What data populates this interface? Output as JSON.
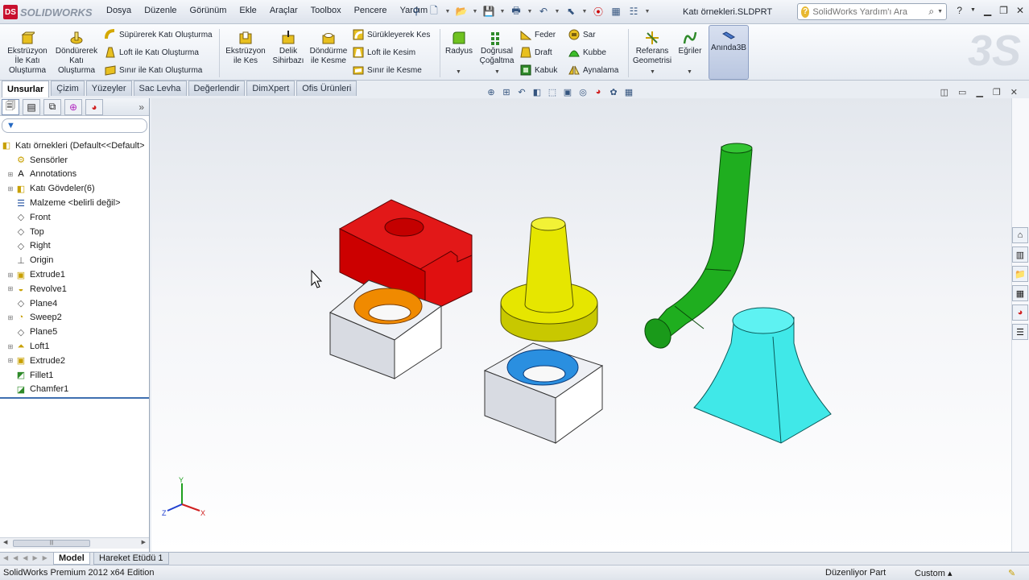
{
  "app": {
    "logo_text": "SOLIDWORKS",
    "document_title": "Katı örnekleri.SLDPRT"
  },
  "menu": [
    "Dosya",
    "Düzenle",
    "Görünüm",
    "Ekle",
    "Araçlar",
    "Toolbox",
    "Pencere",
    "Yardım"
  ],
  "help_search": {
    "placeholder": "SolidWorks Yardım'ı Ara"
  },
  "ribbon": {
    "extrude_boss": "Ekstrüzyon İle Katı Oluşturma",
    "revolve_boss": "Döndürerek Katı Oluşturma",
    "sweep_boss": "Süpürerek Katı Oluşturma",
    "loft_boss": "Loft ile Katı Oluşturma",
    "boundary_boss": "Sınır ile Katı Oluşturma",
    "extrude_cut": "Ekstrüzyon ile Kes",
    "hole_wizard": "Delik Sihirbazı",
    "revolve_cut": "Döndürme ile Kesme",
    "sweep_cut": "Sürükleyerek Kes",
    "loft_cut": "Loft ile Kesim",
    "boundary_cut": "Sınır ile Kesme",
    "fillet": "Radyus",
    "linear_pattern": "Doğrusal Çoğaltma",
    "rib": "Feder",
    "draft": "Draft",
    "shell": "Kabuk",
    "wrap": "Sar",
    "dome": "Kubbe",
    "mirror": "Aynalama",
    "ref_geometry": "Referans Geometrisi",
    "curves": "Eğriler",
    "instant3d": "Anında3B"
  },
  "tabs": [
    "Unsurlar",
    "Çizim",
    "Yüzeyler",
    "Sac Levha",
    "Değerlendir",
    "DimXpert",
    "Ofis Ürünleri"
  ],
  "tree": {
    "root": "Katı örnekleri  (Default<<Default>",
    "items": [
      {
        "label": "Sensörler",
        "icon": "sensor-icon",
        "expandable": false
      },
      {
        "label": "Annotations",
        "icon": "annotations-icon",
        "expandable": true
      },
      {
        "label": "Katı Gövdeler(6)",
        "icon": "solid-bodies-icon",
        "expandable": true
      },
      {
        "label": "Malzeme <belirli değil>",
        "icon": "material-icon",
        "expandable": false
      },
      {
        "label": "Front",
        "icon": "plane-icon",
        "expandable": false
      },
      {
        "label": "Top",
        "icon": "plane-icon",
        "expandable": false
      },
      {
        "label": "Right",
        "icon": "plane-icon",
        "expandable": false
      },
      {
        "label": "Origin",
        "icon": "origin-icon",
        "expandable": false
      },
      {
        "label": "Extrude1",
        "icon": "extrude-icon",
        "expandable": true
      },
      {
        "label": "Revolve1",
        "icon": "revolve-icon",
        "expandable": true
      },
      {
        "label": "Plane4",
        "icon": "plane-icon",
        "expandable": false
      },
      {
        "label": "Sweep2",
        "icon": "sweep-icon",
        "expandable": true
      },
      {
        "label": "Plane5",
        "icon": "plane-icon",
        "expandable": false
      },
      {
        "label": "Loft1",
        "icon": "loft-icon",
        "expandable": true
      },
      {
        "label": "Extrude2",
        "icon": "extrude-icon",
        "expandable": true
      },
      {
        "label": "Fillet1",
        "icon": "fillet-icon",
        "expandable": false
      },
      {
        "label": "Chamfer1",
        "icon": "chamfer-icon",
        "expandable": false
      }
    ]
  },
  "bottom_tabs": [
    "Model",
    "Hareket Etüdü 1"
  ],
  "status": {
    "edition": "SolidWorks Premium 2012 x64 Edition",
    "mode": "Düzenliyor Part",
    "units": "Custom"
  },
  "triad": {
    "x": "X",
    "y": "Y",
    "z": "Z"
  },
  "colors": {
    "red_part": "#d40000",
    "yellow_part": "#e6e600",
    "green_part": "#1fae1f",
    "cyan_part": "#40e8e8",
    "orange_counterbore": "#f08a00",
    "blue_counterbore": "#2a8fe0"
  }
}
